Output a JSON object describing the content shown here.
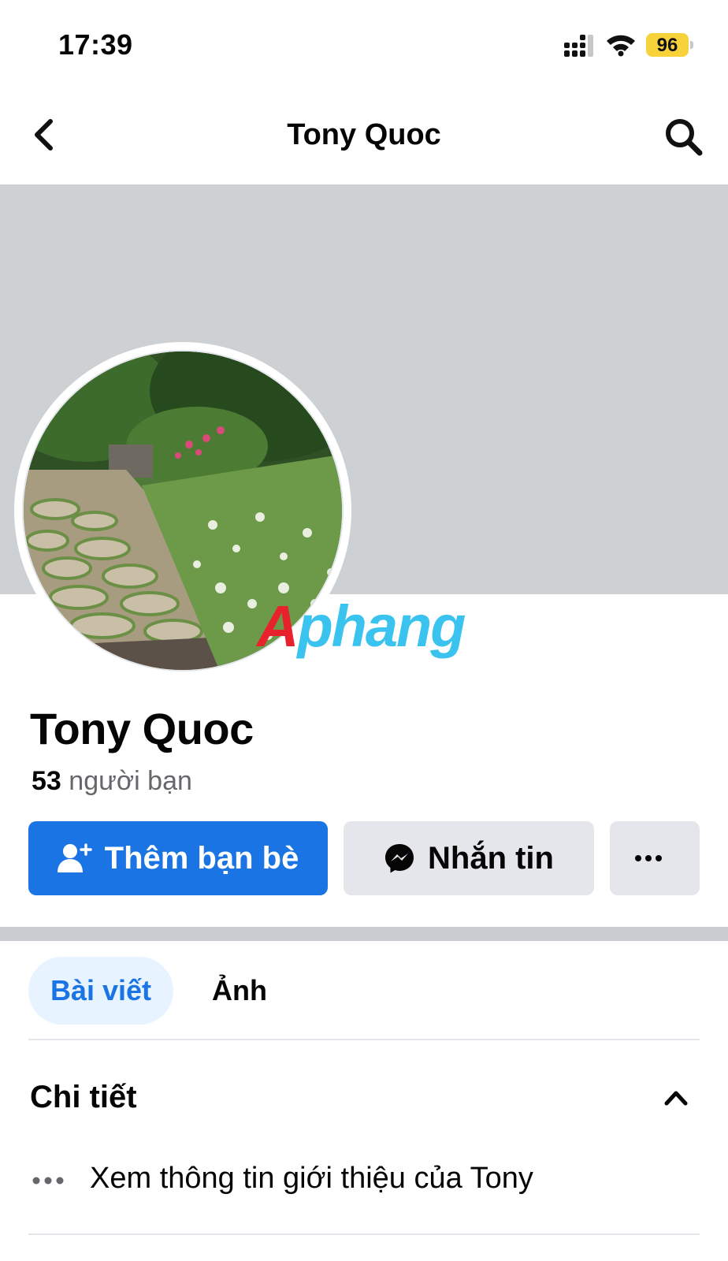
{
  "status_bar": {
    "time": "17:39",
    "battery_level": "96",
    "icons": [
      "signal-icon",
      "wifi-icon",
      "battery-icon"
    ]
  },
  "header": {
    "title": "Tony Quoc",
    "back_icon": "chevron-left-icon",
    "search_icon": "search-icon"
  },
  "watermark": {
    "first_letter": "A",
    "rest": "phang"
  },
  "profile": {
    "name": "Tony Quoc",
    "friends_count": "53",
    "friends_label": "người bạn"
  },
  "actions": {
    "add_friend": "Thêm bạn bè",
    "message": "Nhắn tin",
    "more": "···"
  },
  "tabs": [
    {
      "label": "Bài viết",
      "active": true
    },
    {
      "label": "Ảnh",
      "active": false
    }
  ],
  "details": {
    "title": "Chi tiết",
    "about_link": "Xem thông tin giới thiệu của Tony"
  },
  "colors": {
    "primary": "#1b74e4",
    "secondary_button": "#e4e6eb",
    "cover": "#cdd1d4",
    "active_tab_bg": "#e7f3ff",
    "battery": "#f7d23a"
  }
}
